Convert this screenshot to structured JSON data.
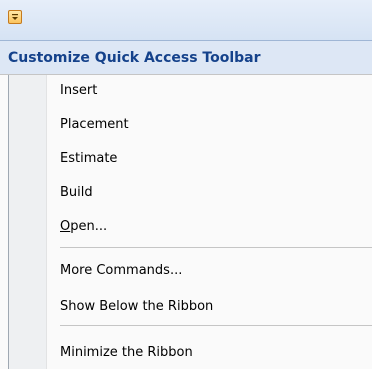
{
  "qat": {
    "button_icon": "dropdown-arrow-icon",
    "button_color": "#fbc35e"
  },
  "menu": {
    "header": "Customize Quick Access Toolbar",
    "items": [
      {
        "label": "Insert"
      },
      {
        "label": "Placement"
      },
      {
        "label": "Estimate"
      },
      {
        "label": "Build"
      },
      {
        "label": "Open...",
        "access_key": "O",
        "label_rest": "pen..."
      },
      {
        "label": "More Commands..."
      },
      {
        "label": "Show Below the Ribbon"
      },
      {
        "label": "Minimize the Ribbon"
      }
    ]
  },
  "colors": {
    "header_text": "#15428b",
    "header_bg": "#dde7f5"
  }
}
